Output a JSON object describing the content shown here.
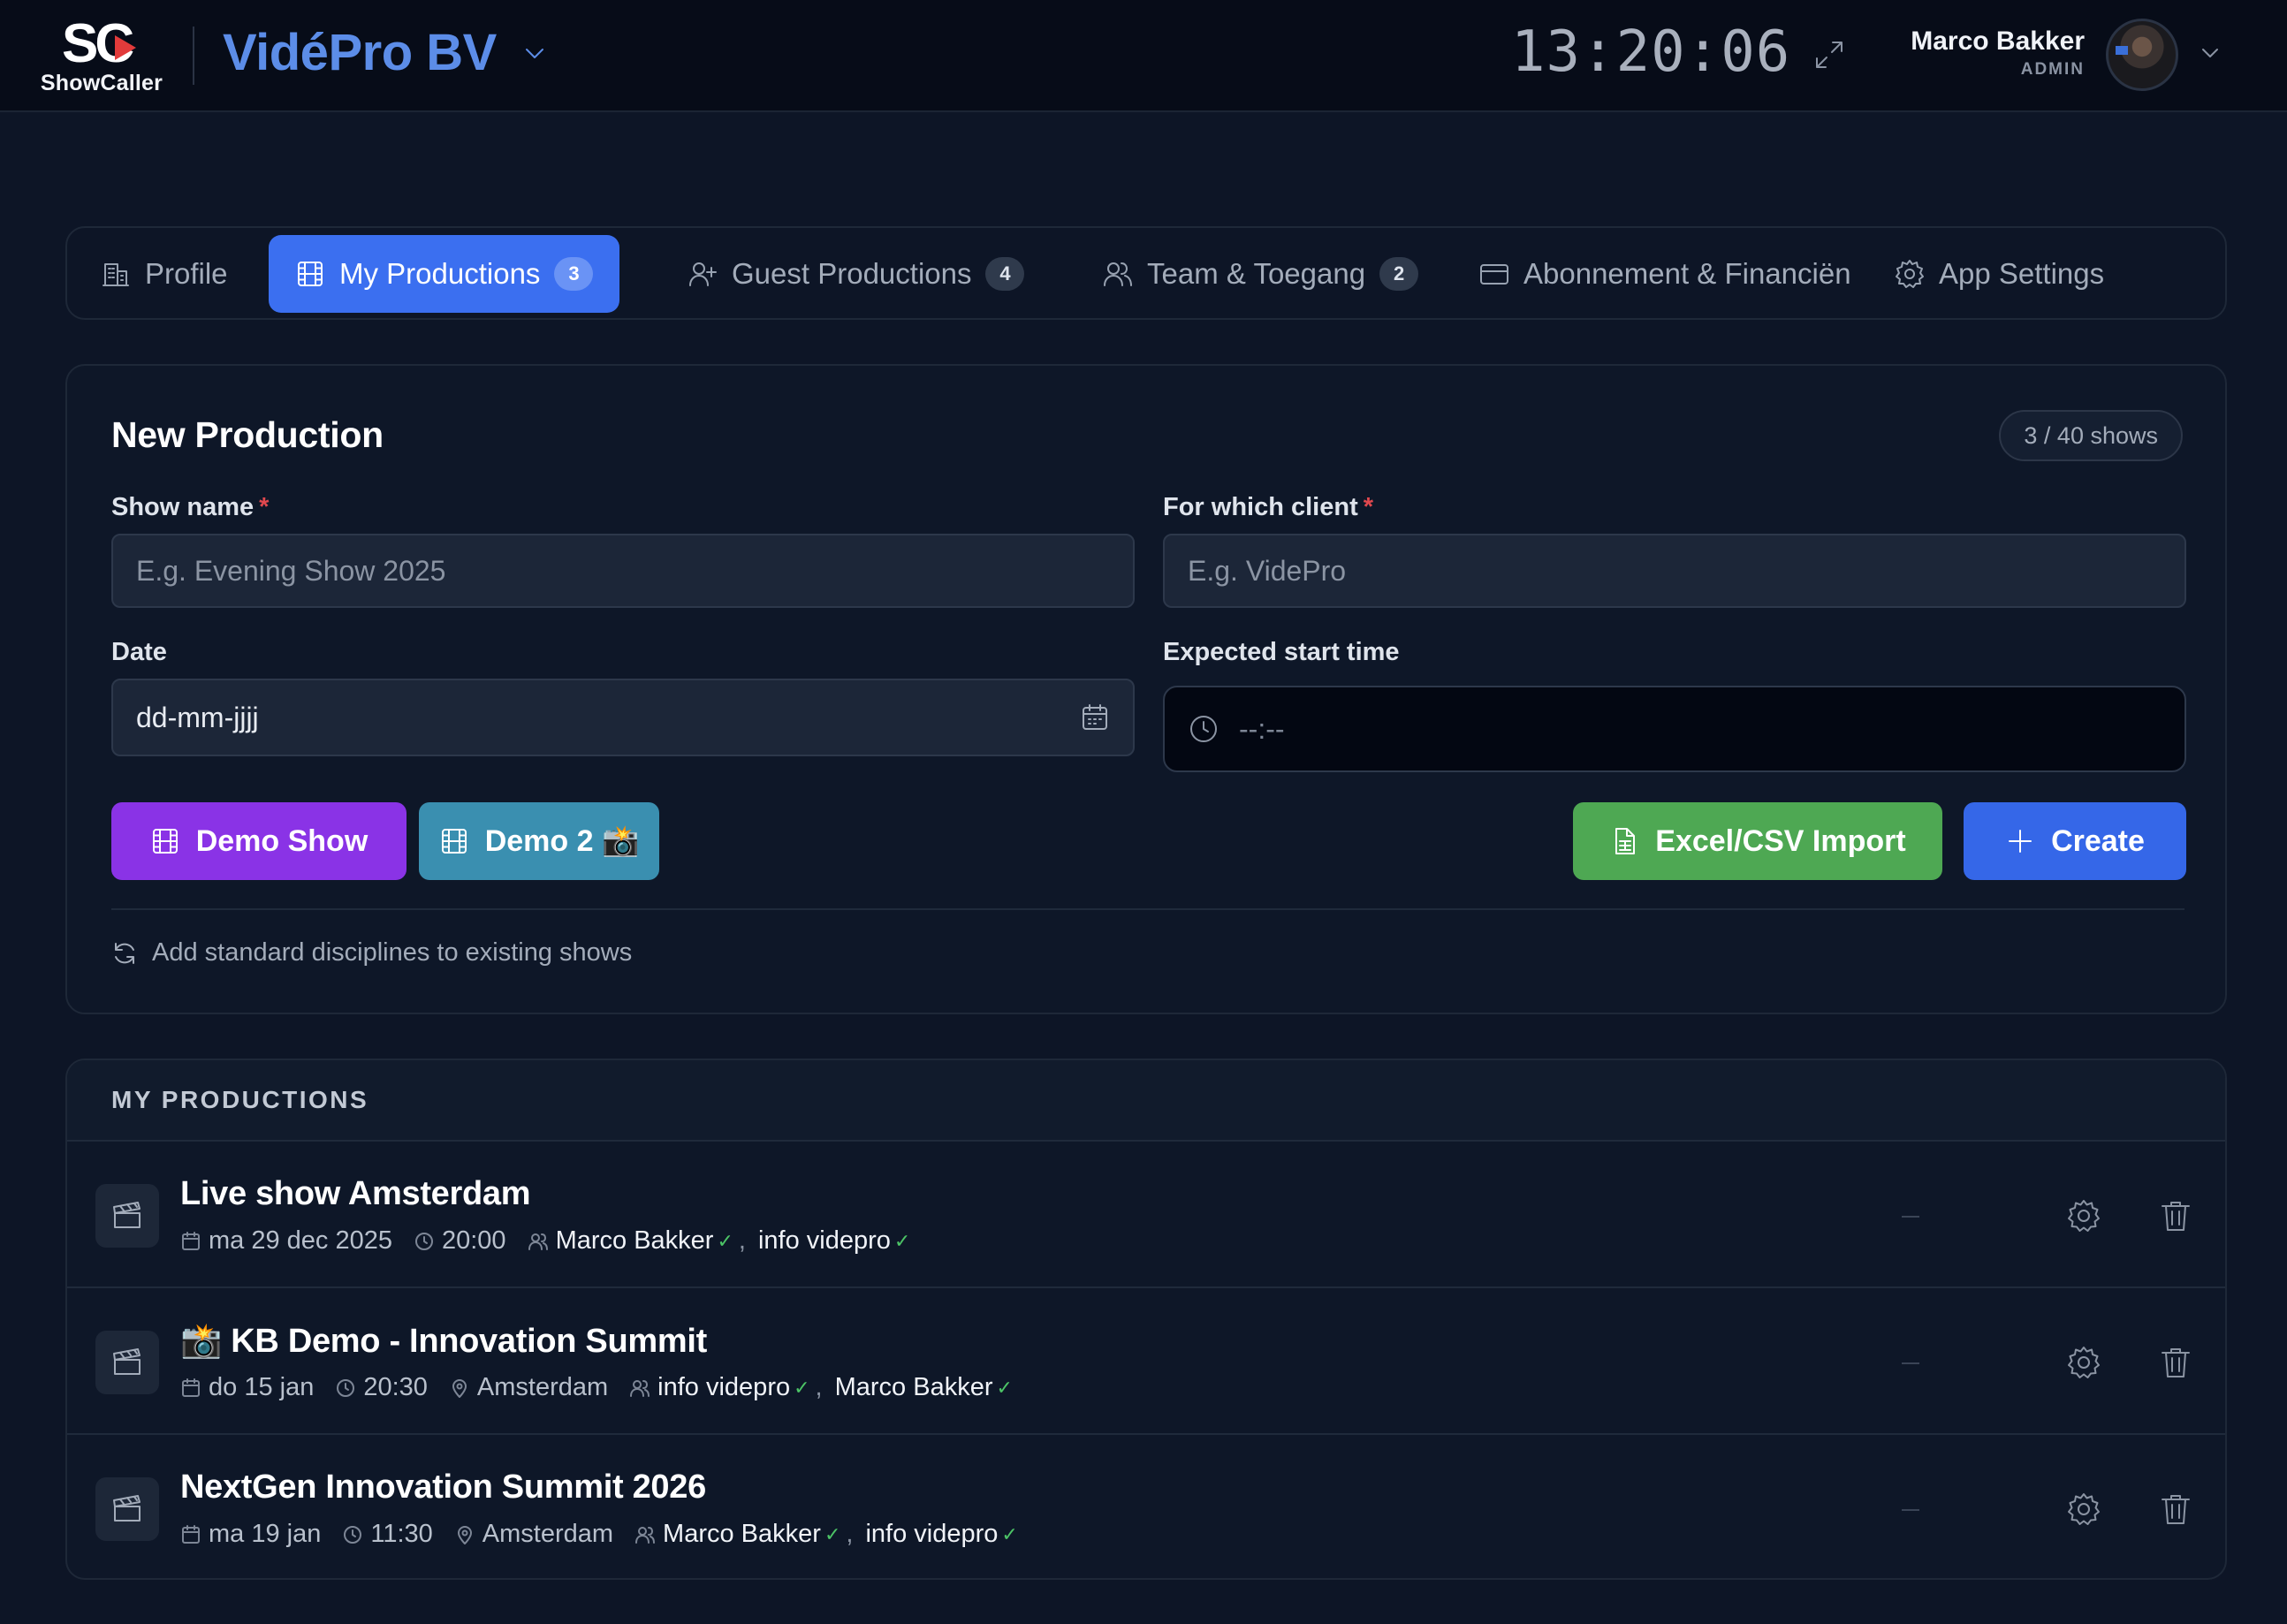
{
  "colors": {
    "background": "#0d1526",
    "topbar": "#070c18",
    "accent_blue": "#3b6ff0",
    "org_name": "#5c8de8",
    "demo_purple": "#8a33e6",
    "demo_teal": "#3a8fb0",
    "import_green": "#4ea853",
    "create_blue": "#3567e8",
    "required_red": "#e0484e",
    "verified_green": "#4cc466"
  },
  "topbar": {
    "logo_mark": "SC",
    "logo_text": "ShowCaller",
    "org_name": "VidéPro BV",
    "org_chevron_icon": "chevron-down-icon",
    "clock": "13:20:06",
    "expand_icon": "expand-icon",
    "user_name": "Marco Bakker",
    "user_role": "ADMIN"
  },
  "tabs": [
    {
      "label": "Profile",
      "icon": "building-icon",
      "count": null,
      "active": false
    },
    {
      "label": "My Productions",
      "icon": "film-icon",
      "count": "3",
      "active": true
    },
    {
      "label": "Guest Productions",
      "icon": "user-plus-icon",
      "count": "4",
      "active": false
    },
    {
      "label": "Team & Toegang",
      "icon": "users-icon",
      "count": "2",
      "active": false
    },
    {
      "label": "Abonnement & Financiën",
      "icon": "credit-card-icon",
      "count": null,
      "active": false
    },
    {
      "label": "App Settings",
      "icon": "gear-icon",
      "count": null,
      "active": false
    }
  ],
  "new_production": {
    "title": "New Production",
    "quota": "3 / 40 shows",
    "show_name": {
      "label": "Show name",
      "required": "*",
      "placeholder": "E.g. Evening Show 2025"
    },
    "client": {
      "label": "For which client",
      "required": "*",
      "placeholder": "E.g. VidePro"
    },
    "date": {
      "label": "Date",
      "value": "dd-mm-jjjj"
    },
    "start_time": {
      "label": "Expected start time",
      "value": "--:--"
    },
    "buttons": {
      "demo_show": "Demo Show",
      "demo_2": "Demo 2 📸",
      "import": "Excel/CSV Import",
      "create": "Create"
    },
    "sync_link": "Add standard disciplines to existing shows"
  },
  "productions": {
    "header": "MY PRODUCTIONS",
    "items": [
      {
        "title": "Live show Amsterdam",
        "date": "ma 29 dec 2025",
        "time": "20:00",
        "location": null,
        "people": [
          "Marco Bakker",
          "info videpro"
        ],
        "status": "–"
      },
      {
        "title": "📸 KB Demo - Innovation Summit",
        "date": "do 15 jan",
        "time": "20:30",
        "location": "Amsterdam",
        "people": [
          "info videpro",
          "Marco Bakker"
        ],
        "status": "–"
      },
      {
        "title": "NextGen Innovation Summit 2026",
        "date": "ma 19 jan",
        "time": "11:30",
        "location": "Amsterdam",
        "people": [
          "Marco Bakker",
          "info videpro"
        ],
        "status": "–"
      }
    ]
  }
}
